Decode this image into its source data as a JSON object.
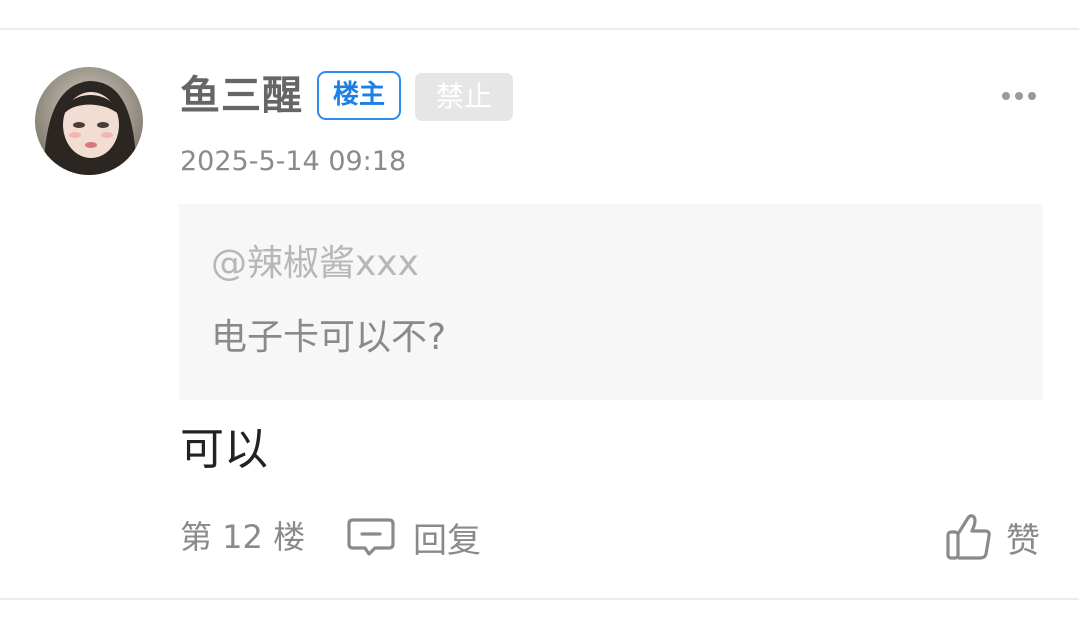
{
  "comment": {
    "username": "鱼三醒",
    "badges": {
      "owner": "楼主",
      "ban": "禁止"
    },
    "timestamp": "2025-5-14 09:18",
    "quote": {
      "mention": "@辣椒酱xxx",
      "text": "电子卡可以不?"
    },
    "content": "可以",
    "floor": "第 12 楼",
    "actions": {
      "reply": "回复",
      "like": "赞"
    },
    "icons": [
      "avatar",
      "more-icon",
      "reply-icon",
      "thumbs-up-icon"
    ]
  },
  "colors": {
    "owner_badge": "#2d8cf0",
    "ban_badge_bg": "#e6e6e6",
    "quote_bg": "#f7f7f7",
    "muted_text": "#8a8a8a"
  }
}
